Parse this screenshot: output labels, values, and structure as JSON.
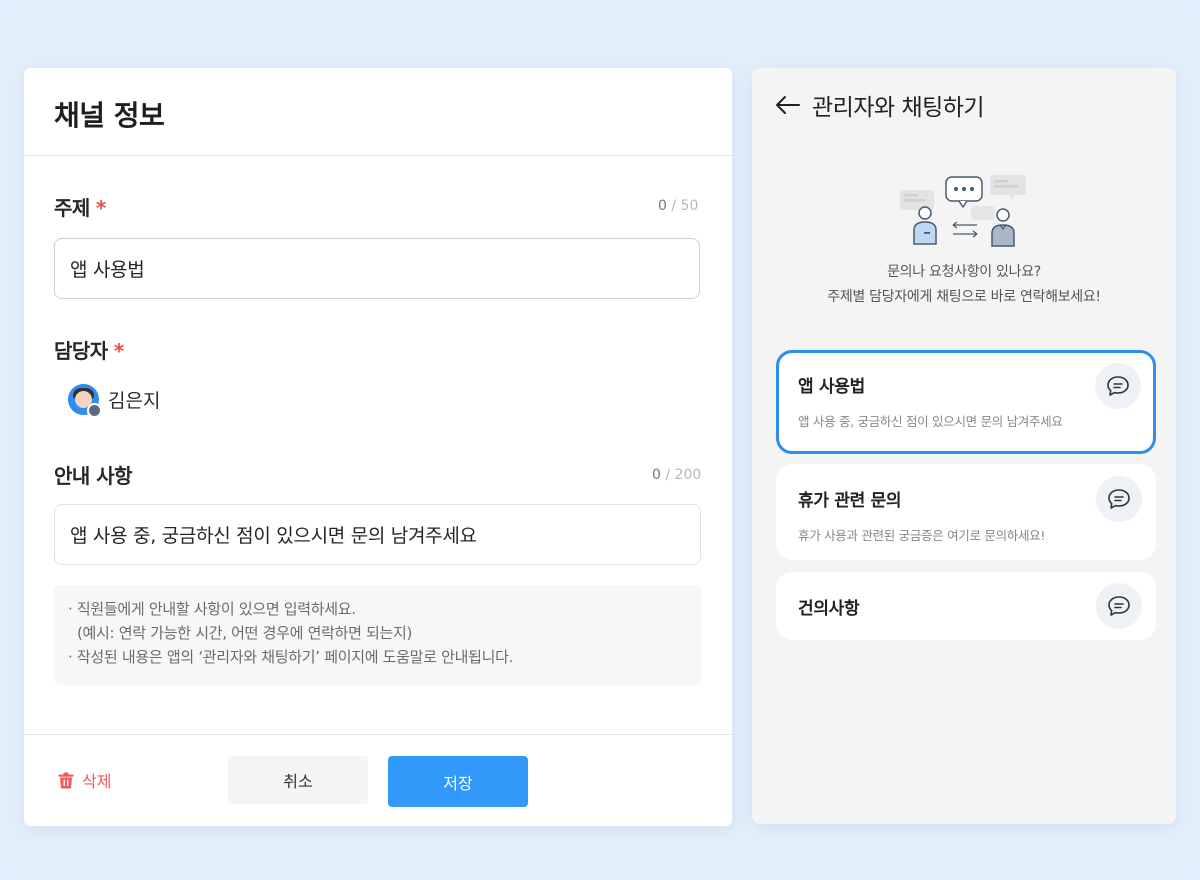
{
  "channel_info": {
    "title": "채널 정보",
    "subject": {
      "label": "주제",
      "required_mark": "*",
      "count_current": "0",
      "count_sep": "/",
      "count_max": "50",
      "value": "앱 사용법"
    },
    "assignee": {
      "label": "담당자",
      "required_mark": "*",
      "name": "김은지"
    },
    "guide": {
      "label": "안내 사항",
      "count_current": "0",
      "count_sep": "/",
      "count_max": "200",
      "value": "앱 사용 중, 궁금하신 점이 있으시면 문의 남겨주세요"
    },
    "hints": [
      "· 직원들에게 안내할 사항이 있으면 입력하세요.",
      "(예시: 연락 가능한 시간, 어떤 경우에 연락하면 되는지)",
      "· 작성된 내용은 앱의 ‘관리자와 채팅하기’ 페이지에 도움말로 안내됩니다."
    ],
    "footer": {
      "delete_label": "삭제",
      "cancel_label": "취소",
      "save_label": "저장"
    }
  },
  "chat_preview": {
    "title": "관리자와 채팅하기",
    "intro_line1": "문의나 요청사항이 있나요?",
    "intro_line2": "주제별 담당자에게 채팅으로 바로 연락해보세요!",
    "topics": [
      {
        "title": "앱 사용법",
        "desc": "앱 사용 중, 궁금하신 점이 있으시면 문의 남겨주세요",
        "selected": true
      },
      {
        "title": "휴가 관련 문의",
        "desc": "휴가 사용과 관련된 궁금증은 여기로 문의하세요!",
        "selected": false
      },
      {
        "title": "건의사항",
        "desc": "",
        "selected": false
      }
    ]
  },
  "colors": {
    "accent": "#3299fb",
    "selected_border": "#2d8ef0",
    "required": "#ef4a4a",
    "delete": "#ef5a5a",
    "background": "#e3effb"
  },
  "icons": [
    "trash-icon",
    "back-arrow-icon",
    "chat-bubble-icon",
    "chat-illustration",
    "avatar"
  ]
}
